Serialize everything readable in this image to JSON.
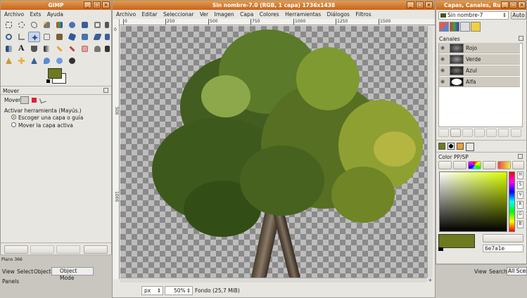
{
  "toolbox": {
    "title": "GIMP",
    "menu": [
      "Archivo",
      "Exts",
      "Ayuda"
    ],
    "options_title": "Mover",
    "mover_label": "Mover:",
    "activate_label": "Activar herramienta (Mayús.)",
    "option1": "Escoger una capa o guía",
    "option2": "Mover la capa activa",
    "fg_color": "#6e7a1e"
  },
  "image_window": {
    "title": "Sin nombre-7.0 (RGB, 1 capa) 1736x1438",
    "menu": [
      "Archivo",
      "Editar",
      "Seleccionar",
      "Ver",
      "Imagen",
      "Capa",
      "Colores",
      "Herramientas",
      "Diálogos",
      "Filtros"
    ],
    "ruler_ticks": [
      "0",
      "250",
      "500",
      "750",
      "1000",
      "1250",
      "1500"
    ],
    "vruler_ticks": [
      "0",
      "500",
      "1000"
    ],
    "unit": "px",
    "zoom": "50%",
    "status": "Fondo (25,7 MiB)"
  },
  "dock": {
    "title": "Capas, Canales, Ru",
    "image_select": "Sin nombre-7",
    "auto_label": "Auto",
    "channels_title": "Canales",
    "channels": [
      "Rojo",
      "Verde",
      "Azul",
      "Alfa"
    ],
    "color_title": "Color PP/SP",
    "hex_value": "6e7a1e",
    "fg_color": "#6e7a1e"
  },
  "taskbar": {
    "left_status": "Plano 366",
    "view": "View",
    "select": "Select",
    "object": "Object",
    "object_mode": "Object Mode",
    "panels": "Panels",
    "right_view": "View",
    "right_search": "Search",
    "right_scene": "All Scene"
  },
  "colors": {
    "accent": "#d07a2e",
    "canvas_bg": "#7a7a7a"
  }
}
